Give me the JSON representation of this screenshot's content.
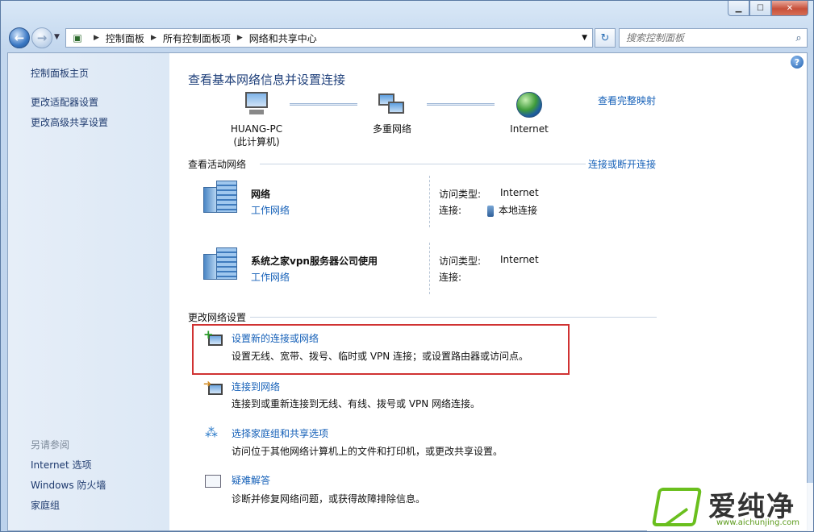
{
  "window": {
    "minimize": "▁",
    "maximize": "☐",
    "close": "✕"
  },
  "nav": {
    "breadcrumb": [
      "控制面板",
      "所有控制面板项",
      "网络和共享中心"
    ],
    "search_placeholder": "搜索控制面板"
  },
  "sidebar": {
    "links": [
      "控制面板主页",
      "更改适配器设置",
      "更改高级共享设置"
    ],
    "see_also_heading": "另请参阅",
    "see_also": [
      "Internet 选项",
      "Windows 防火墙",
      "家庭组"
    ]
  },
  "main": {
    "title": "查看基本网络信息并设置连接",
    "view_full_map": "查看完整映射",
    "map": {
      "computer_name": "HUANG-PC",
      "computer_sub": "(此计算机)",
      "middle": "多重网络",
      "internet": "Internet"
    },
    "active_networks": {
      "title": "查看活动网络",
      "connect_disconnect": "连接或断开连接",
      "label_access_type": "访问类型:",
      "label_connection": "连接:",
      "networks": [
        {
          "name": "网络",
          "type": "工作网络",
          "access_type": "Internet",
          "connection": "本地连接"
        },
        {
          "name": "系统之家vpn服务器公司使用",
          "type": "工作网络",
          "access_type": "Internet",
          "connection": ""
        }
      ]
    },
    "change_settings": {
      "title": "更改网络设置",
      "tasks": [
        {
          "title": "设置新的连接或网络",
          "desc": "设置无线、宽带、拨号、临时或 VPN 连接；或设置路由器或访问点。"
        },
        {
          "title": "连接到网络",
          "desc": "连接到或重新连接到无线、有线、拨号或 VPN 网络连接。"
        },
        {
          "title": "选择家庭组和共享选项",
          "desc": "访问位于其他网络计算机上的文件和打印机，或更改共享设置。"
        },
        {
          "title": "疑难解答",
          "desc": "诊断并修复网络问题，或获得故障排除信息。"
        }
      ]
    }
  },
  "watermark": {
    "text": "爱纯净",
    "url": "www.aichunjing.com"
  },
  "colors": {
    "link": "#1560b8",
    "highlight_border": "#d03232",
    "heading": "#1e3f7a"
  }
}
